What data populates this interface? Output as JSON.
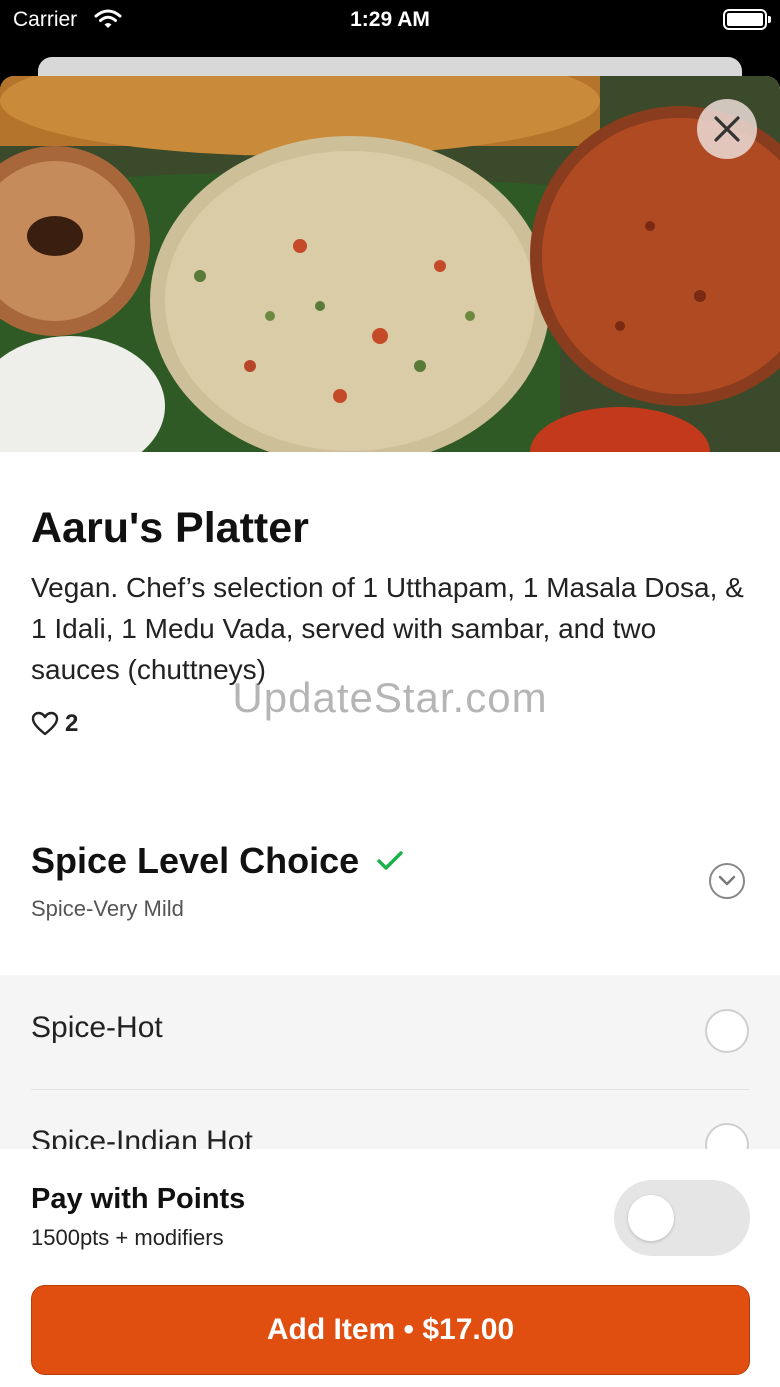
{
  "status_bar": {
    "carrier": "Carrier",
    "time": "1:29 AM"
  },
  "item": {
    "title": "Aaru's Platter",
    "description": "Vegan. Chef’s selection of 1 Utthapam, 1 Masala Dosa, & 1 Idali, 1 Medu Vada, served with sambar, and two sauces (chuttneys)",
    "likes": "2"
  },
  "watermark": "UpdateStar.com",
  "modifier_group": {
    "title": "Spice Level Choice",
    "selected": "Spice-Very Mild",
    "options": [
      {
        "label": "Spice-Hot"
      },
      {
        "label": "Spice-Indian Hot"
      }
    ]
  },
  "footer": {
    "pay_title": "Pay with Points",
    "pay_subtitle": "1500pts + modifiers",
    "pay_toggle_on": false,
    "add_button": "Add Item • $17.00"
  },
  "colors": {
    "accent": "#e04f10",
    "check": "#17b34a"
  }
}
